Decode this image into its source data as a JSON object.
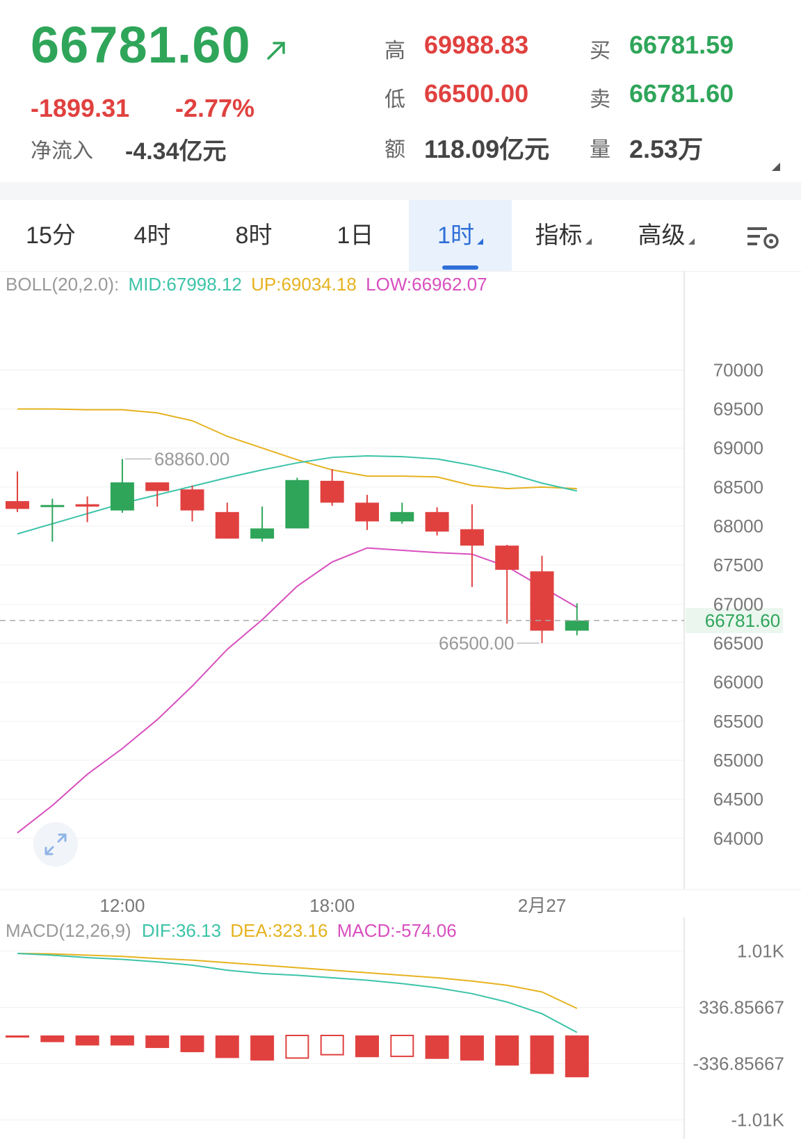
{
  "quote": {
    "price": "66781.60",
    "change": "-1899.31",
    "change_pct": "-2.77%",
    "net_inflow_label": "净流入",
    "net_inflow_value": "-4.34亿元",
    "high_label": "高",
    "high_value": "69988.83",
    "low_label": "低",
    "low_value": "66500.00",
    "amount_label": "额",
    "amount_value": "118.09亿元",
    "bid_label": "买",
    "bid_value": "66781.59",
    "ask_label": "卖",
    "ask_value": "66781.60",
    "volume_label": "量",
    "volume_value": "2.53万",
    "colors": {
      "up": "#2fa55a",
      "down": "#e0413f"
    }
  },
  "toolbar": {
    "tabs": [
      {
        "label": "15分"
      },
      {
        "label": "4时"
      },
      {
        "label": "8时"
      },
      {
        "label": "1日"
      },
      {
        "label": "1时",
        "active": true
      },
      {
        "label": "指标"
      },
      {
        "label": "高级"
      }
    ],
    "settings_icon": "chart-settings-icon"
  },
  "boll": {
    "name": "BOLL(20,2.0):",
    "mid": "MID:67998.12",
    "up": "UP:69034.18",
    "low": "LOW:66962.07",
    "colors": {
      "mid": "#3cc3a8",
      "up": "#e6b21f",
      "low": "#d84fbf"
    }
  },
  "macd": {
    "name": "MACD(12,26,9)",
    "dif": "DIF:36.13",
    "dea": "DEA:323.16",
    "value": "MACD:-574.06"
  },
  "chart_data": [
    {
      "type": "candlestick",
      "interval": "1时",
      "ylim": [
        63700,
        70600
      ],
      "y_ticks": [
        "70000",
        "69500",
        "69000",
        "68500",
        "68000",
        "67500",
        "67000",
        "66500",
        "66000",
        "65500",
        "65000",
        "64500",
        "64000"
      ],
      "x_ticks": [
        {
          "label": "12:00",
          "index": 3
        },
        {
          "label": "18:00",
          "index": 9
        },
        {
          "label": "2月27",
          "index": 15
        }
      ],
      "current_price_label": "66781.60",
      "annotations": [
        {
          "text": "68860.00",
          "index": 3,
          "value": 68860
        },
        {
          "text": "66500.00",
          "index": 15,
          "value": 66500
        }
      ],
      "candles": [
        {
          "o": 68320,
          "h": 68700,
          "l": 68180,
          "c": 68220
        },
        {
          "o": 68250,
          "h": 68350,
          "l": 67800,
          "c": 68270
        },
        {
          "o": 68280,
          "h": 68380,
          "l": 68050,
          "c": 68250
        },
        {
          "o": 68200,
          "h": 68860,
          "l": 68170,
          "c": 68560
        },
        {
          "o": 68560,
          "h": 68560,
          "l": 68250,
          "c": 68450
        },
        {
          "o": 68470,
          "h": 68520,
          "l": 68060,
          "c": 68200
        },
        {
          "o": 68180,
          "h": 68300,
          "l": 67840,
          "c": 67840
        },
        {
          "o": 67840,
          "h": 68250,
          "l": 67800,
          "c": 67970
        },
        {
          "o": 67970,
          "h": 68620,
          "l": 67970,
          "c": 68590
        },
        {
          "o": 68580,
          "h": 68730,
          "l": 68260,
          "c": 68300
        },
        {
          "o": 68300,
          "h": 68400,
          "l": 67950,
          "c": 68060
        },
        {
          "o": 68060,
          "h": 68300,
          "l": 68030,
          "c": 68180
        },
        {
          "o": 68180,
          "h": 68240,
          "l": 67880,
          "c": 67930
        },
        {
          "o": 67960,
          "h": 68280,
          "l": 67220,
          "c": 67750
        },
        {
          "o": 67750,
          "h": 67760,
          "l": 66750,
          "c": 67440
        },
        {
          "o": 67420,
          "h": 67620,
          "l": 66500,
          "c": 66660
        },
        {
          "o": 66660,
          "h": 67010,
          "l": 66600,
          "c": 66790
        }
      ],
      "boll_up": [
        69500,
        69500,
        69490,
        69490,
        69450,
        69350,
        69150,
        69000,
        68850,
        68720,
        68640,
        68640,
        68630,
        68520,
        68480,
        68500,
        68480
      ],
      "boll_mid": [
        67900,
        68030,
        68160,
        68290,
        68400,
        68510,
        68620,
        68720,
        68810,
        68880,
        68900,
        68890,
        68860,
        68780,
        68680,
        68550,
        68450
      ],
      "boll_low": [
        64070,
        64420,
        64820,
        65150,
        65520,
        65950,
        66420,
        66800,
        67230,
        67540,
        67720,
        67690,
        67660,
        67640,
        67480,
        67220,
        66960
      ]
    },
    {
      "type": "macd",
      "y_ticks": [
        "1.01K",
        "336.85667",
        "-336.85667",
        "-1.01K"
      ],
      "ylim": [
        -1080,
        1080
      ],
      "hist": [
        -20,
        -80,
        -120,
        -120,
        -150,
        -200,
        -270,
        -300,
        -270,
        -230,
        -260,
        -250,
        -280,
        -300,
        -360,
        -460,
        -500
      ],
      "hist_hollow": [
        false,
        false,
        false,
        false,
        false,
        false,
        false,
        false,
        true,
        true,
        false,
        true,
        false,
        false,
        false,
        false,
        false
      ],
      "dif": [
        980,
        960,
        930,
        910,
        880,
        840,
        780,
        740,
        720,
        690,
        660,
        620,
        570,
        500,
        400,
        260,
        36
      ],
      "dea": [
        980,
        975,
        960,
        945,
        920,
        900,
        870,
        840,
        810,
        780,
        750,
        720,
        690,
        650,
        600,
        520,
        323
      ]
    }
  ]
}
